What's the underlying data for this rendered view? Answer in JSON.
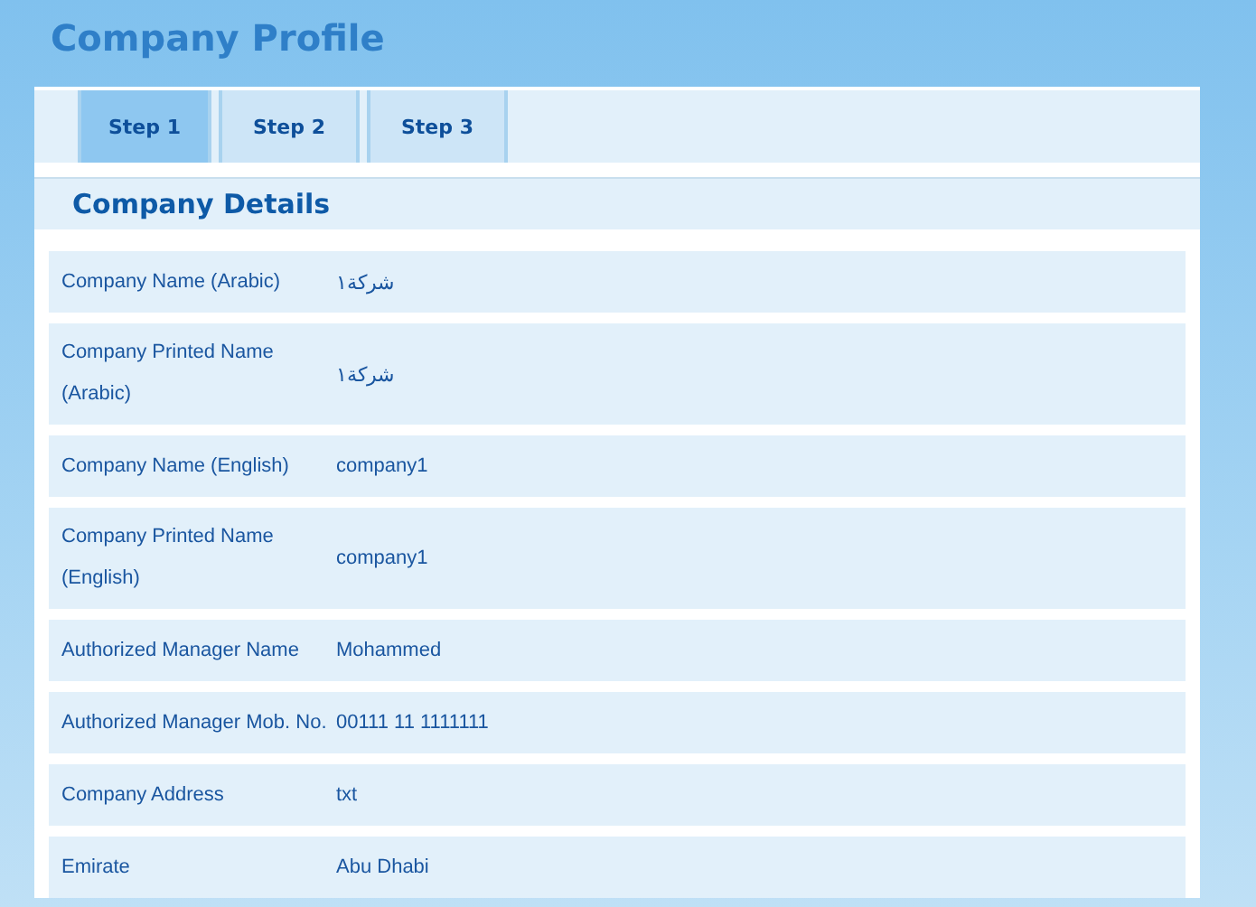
{
  "page_title": "Company Profile",
  "tabs": [
    {
      "label": "Step 1",
      "selected": true
    },
    {
      "label": "Step 2",
      "selected": false
    },
    {
      "label": "Step 3",
      "selected": false
    }
  ],
  "section_title": "Company Details",
  "fields": [
    {
      "label": "Company Name (Arabic)",
      "value": "شركة١"
    },
    {
      "label": "Company Printed Name (Arabic)",
      "value": "شركة١"
    },
    {
      "label": "Company Name (English)",
      "value": "company1"
    },
    {
      "label": "Company Printed Name (English)",
      "value": "company1"
    },
    {
      "label": "Authorized Manager Name",
      "value": "Mohammed"
    },
    {
      "label": "Authorized Manager Mob. No.",
      "value": "00111 11 1111111"
    },
    {
      "label": "Company Address",
      "value": "txt"
    },
    {
      "label": "Emirate",
      "value": "Abu Dhabi"
    }
  ]
}
